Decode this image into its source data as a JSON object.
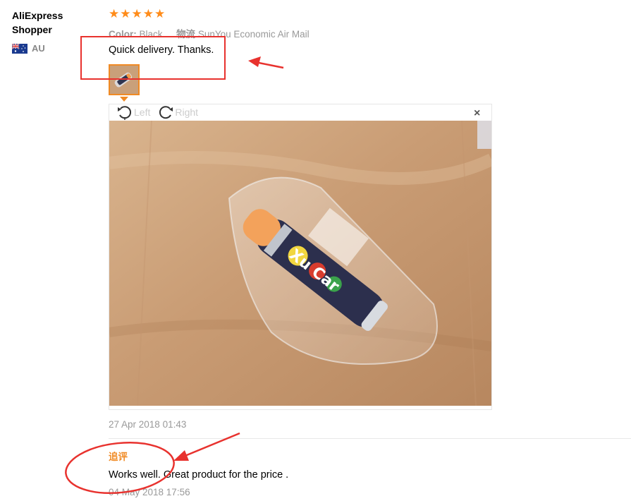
{
  "user": {
    "name": "AliExpress Shopper",
    "country_code": "AU"
  },
  "review": {
    "rating": 5,
    "color_label": "Color:",
    "color_value": "Black",
    "logistics_label": "物流",
    "logistics_value": "SunYou Economic Air Mail",
    "text": "Quick delivery. Thanks.",
    "date": "27 Apr 2018 01:43"
  },
  "viewer": {
    "rotate_left_label": "Left",
    "rotate_right_label": "Right",
    "close_glyph": "×",
    "photo_product_text": "Xu Car"
  },
  "followup": {
    "label": "追评",
    "text": "Works well. Great product for the price .",
    "date": "04 May 2018 17:56"
  },
  "colors": {
    "star": "#ff8c1a",
    "accent": "#f08a24",
    "annotation": "#e8322e"
  },
  "icons": [
    "star-icon",
    "flag-au-icon",
    "rotate-left-icon",
    "rotate-right-icon",
    "close-icon"
  ]
}
